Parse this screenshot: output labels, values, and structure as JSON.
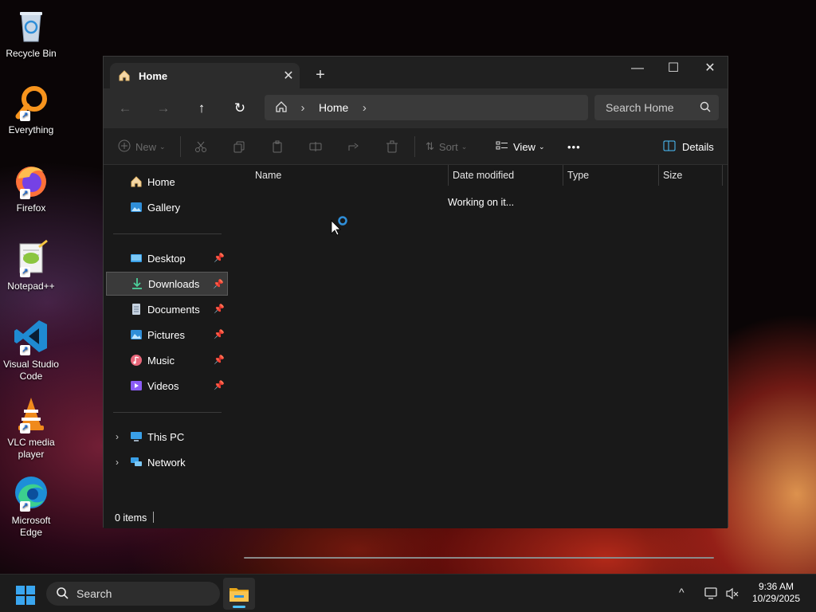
{
  "desktop": {
    "icons": [
      {
        "label": "Recycle Bin"
      },
      {
        "label": "Everything"
      },
      {
        "label": "Firefox"
      },
      {
        "label": "Notepad++"
      },
      {
        "label": "Visual Studio Code"
      },
      {
        "label": "VLC media player"
      },
      {
        "label": "Microsoft Edge"
      }
    ]
  },
  "explorer": {
    "tab": {
      "title": "Home",
      "close": "✕"
    },
    "new_tab": "+",
    "window_controls": {
      "minimize": "—",
      "maximize": "☐",
      "close": "✕"
    },
    "nav": {
      "back": "←",
      "forward": "→",
      "up": "↑",
      "refresh": "↻"
    },
    "address": {
      "crumb": "Home",
      "sep": "›"
    },
    "search": {
      "placeholder": "Search Home"
    },
    "toolbar": {
      "new": "New",
      "sort": "Sort",
      "view": "View",
      "more": "•••",
      "details": "Details"
    },
    "sidebar": {
      "home": "Home",
      "gallery": "Gallery",
      "quick": [
        {
          "label": "Desktop"
        },
        {
          "label": "Downloads"
        },
        {
          "label": "Documents"
        },
        {
          "label": "Pictures"
        },
        {
          "label": "Music"
        },
        {
          "label": "Videos"
        }
      ],
      "this_pc": "This PC",
      "network": "Network"
    },
    "columns": {
      "name": "Name",
      "date": "Date modified",
      "type": "Type",
      "size": "Size"
    },
    "loading_text": "Working on it...",
    "status": {
      "items": "0 items"
    }
  },
  "taskbar": {
    "search": "Search",
    "clock": {
      "time": "9:36 AM",
      "date": "10/29/2025"
    }
  },
  "colors": {
    "accent": "#4cc2ff",
    "folder": "#f8c44f"
  }
}
